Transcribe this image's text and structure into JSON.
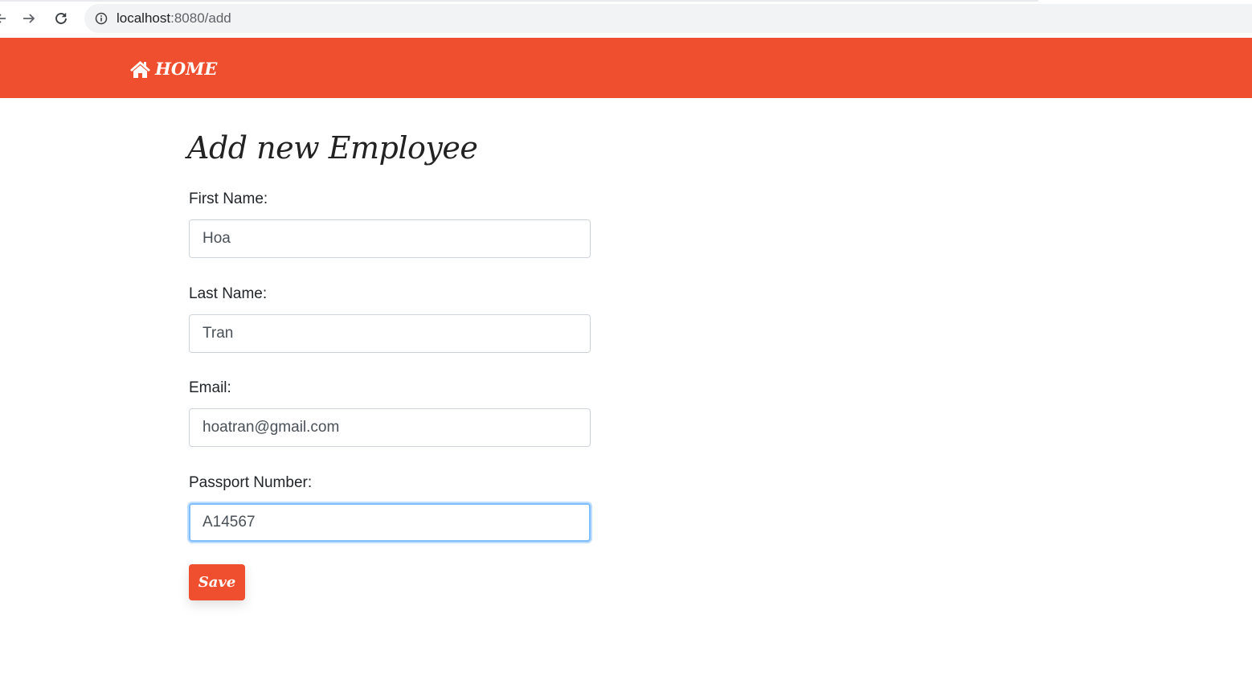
{
  "browser": {
    "url_host": "localhost",
    "url_rest": ":8080/add"
  },
  "navbar": {
    "home_label": "HOME",
    "brand_color": "#ef4f2e",
    "icon": "home-icon"
  },
  "page": {
    "title": "Add new Employee"
  },
  "form": {
    "first_name": {
      "label": "First Name:",
      "value": "Hoa"
    },
    "last_name": {
      "label": "Last Name:",
      "value": "Tran"
    },
    "email": {
      "label": "Email:",
      "value": "hoatran@gmail.com"
    },
    "passport": {
      "label": "Passport Number:",
      "value": "A14567"
    },
    "save_label": "Save"
  }
}
